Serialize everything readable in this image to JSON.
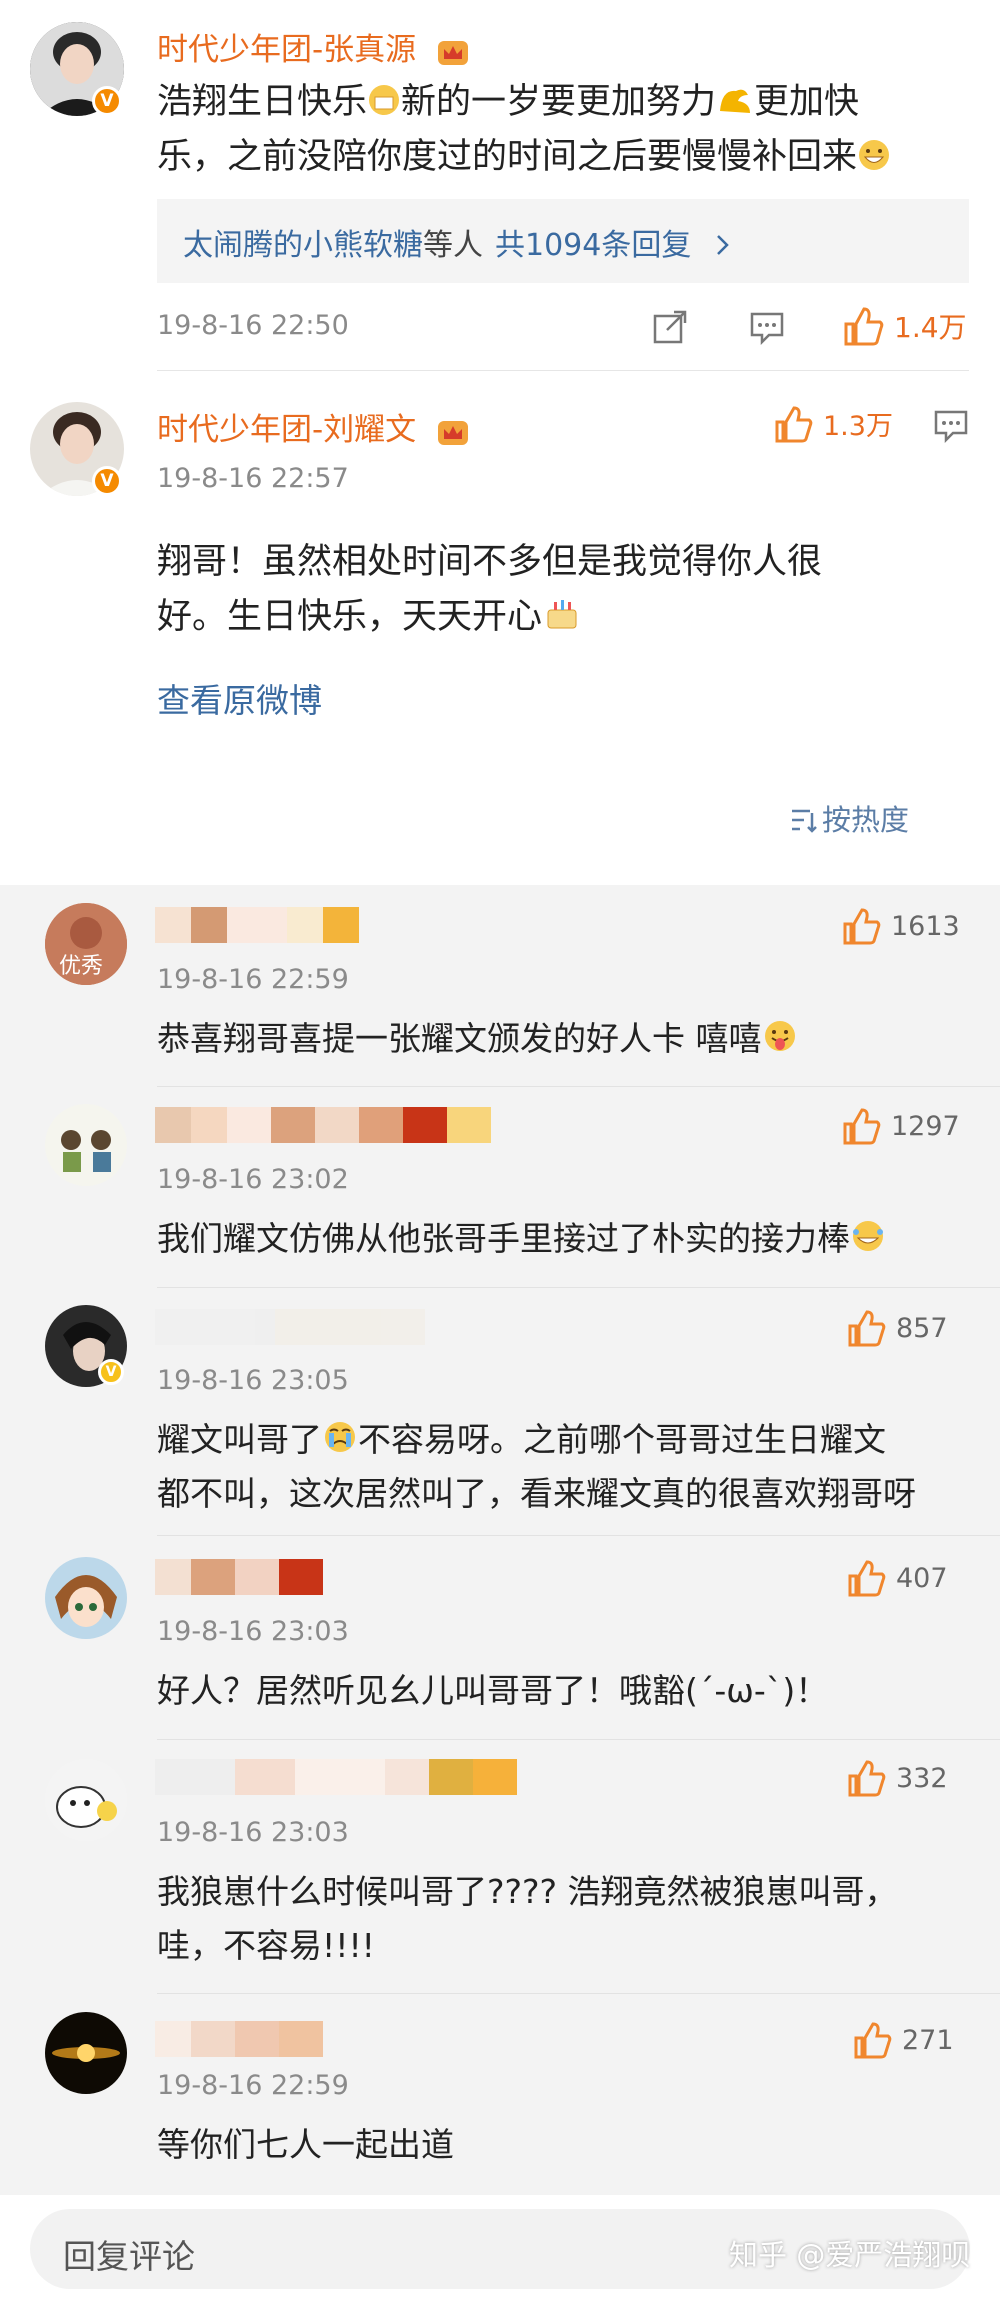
{
  "colors": {
    "accent": "#e86b1f",
    "link": "#3a6aa0",
    "like": "#f0862d",
    "badge": "#f58a00"
  },
  "post1": {
    "username": "时代少年团-张真源",
    "text_line1": "浩翔生日快乐",
    "text_line1b": "新的一岁要更加努力",
    "text_line1c": "更加快",
    "text_line2": "乐，之前没陪你度过的时间之后要慢慢补回来",
    "reply_from": "太闹腾的小熊软糖",
    "reply_mid": "等人",
    "reply_count": "共1094条回复",
    "timestamp": "19-8-16 22:50",
    "likes": "1.4万"
  },
  "post2": {
    "username": "时代少年团-刘耀文",
    "likes": "1.3万",
    "timestamp": "19-8-16 22:57",
    "text_line1": "翔哥！虽然相处时间不多但是我觉得你人很",
    "text_line2": "好。生日快乐，天天开心",
    "view_original": "查看原微博",
    "sort_label": "按热度"
  },
  "comments": [
    {
      "avatar_text": "优秀",
      "timestamp": "19-8-16 22:59",
      "likes": "1613",
      "text": "恭喜翔哥喜提一张耀文颁发的好人卡 嘻嘻"
    },
    {
      "timestamp": "19-8-16 23:02",
      "likes": "1297",
      "text": "我们耀文仿佛从他张哥手里接过了朴实的接力棒"
    },
    {
      "timestamp": "19-8-16 23:05",
      "likes": "857",
      "text_line1": "耀文叫哥了",
      "text_line1b": "不容易呀。之前哪个哥哥过生日耀文",
      "text_line2": "都不叫，这次居然叫了，看来耀文真的很喜欢翔哥呀"
    },
    {
      "timestamp": "19-8-16 23:03",
      "likes": "407",
      "text": "好人？居然听见幺儿叫哥哥了！哦豁(´-ω-`)！"
    },
    {
      "timestamp": "19-8-16 23:03",
      "likes": "332",
      "text_line1": "我狼崽什么时候叫哥了???? 浩翔竟然被狼崽叫哥，",
      "text_line2": "哇，不容易!!!!"
    },
    {
      "timestamp": "19-8-16 22:59",
      "likes": "271",
      "text": "等你们七人一起出道"
    }
  ],
  "footer": {
    "placeholder": "回复评论",
    "watermark": "知乎 @爱严浩翔呗"
  }
}
